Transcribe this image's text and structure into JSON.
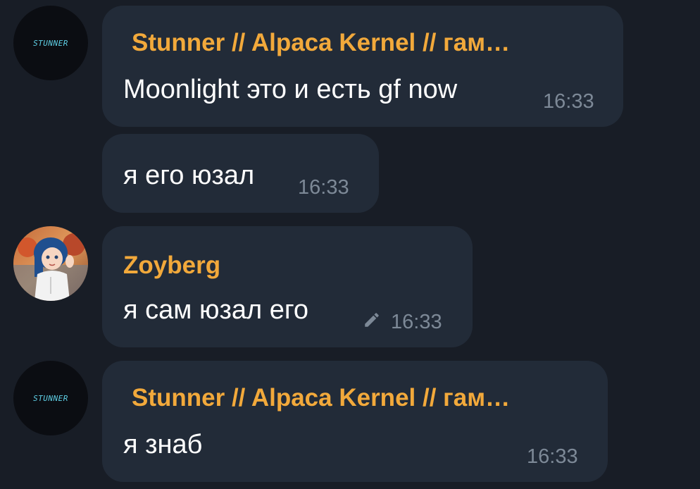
{
  "messages": [
    {
      "sender": "Stunner // Alpaca Kernel // гам…",
      "avatar_text": "STUNNER",
      "text": "Moonlight это и есть gf now",
      "time": "16:33"
    },
    {
      "text": "я его юзал",
      "time": "16:33"
    },
    {
      "sender": "Zoyberg",
      "text": "я сам юзал его",
      "time": "16:33",
      "edited_icon": "pencil-icon"
    },
    {
      "sender": "Stunner // Alpaca Kernel // гам…",
      "avatar_text": "STUNNER",
      "text": "я знаб",
      "time": "16:33"
    }
  ],
  "colors": {
    "background": "#181d26",
    "bubble": "#222b38",
    "sender_name": "#f2a93b",
    "message_text": "#ffffff",
    "timestamp": "#7d8997"
  }
}
